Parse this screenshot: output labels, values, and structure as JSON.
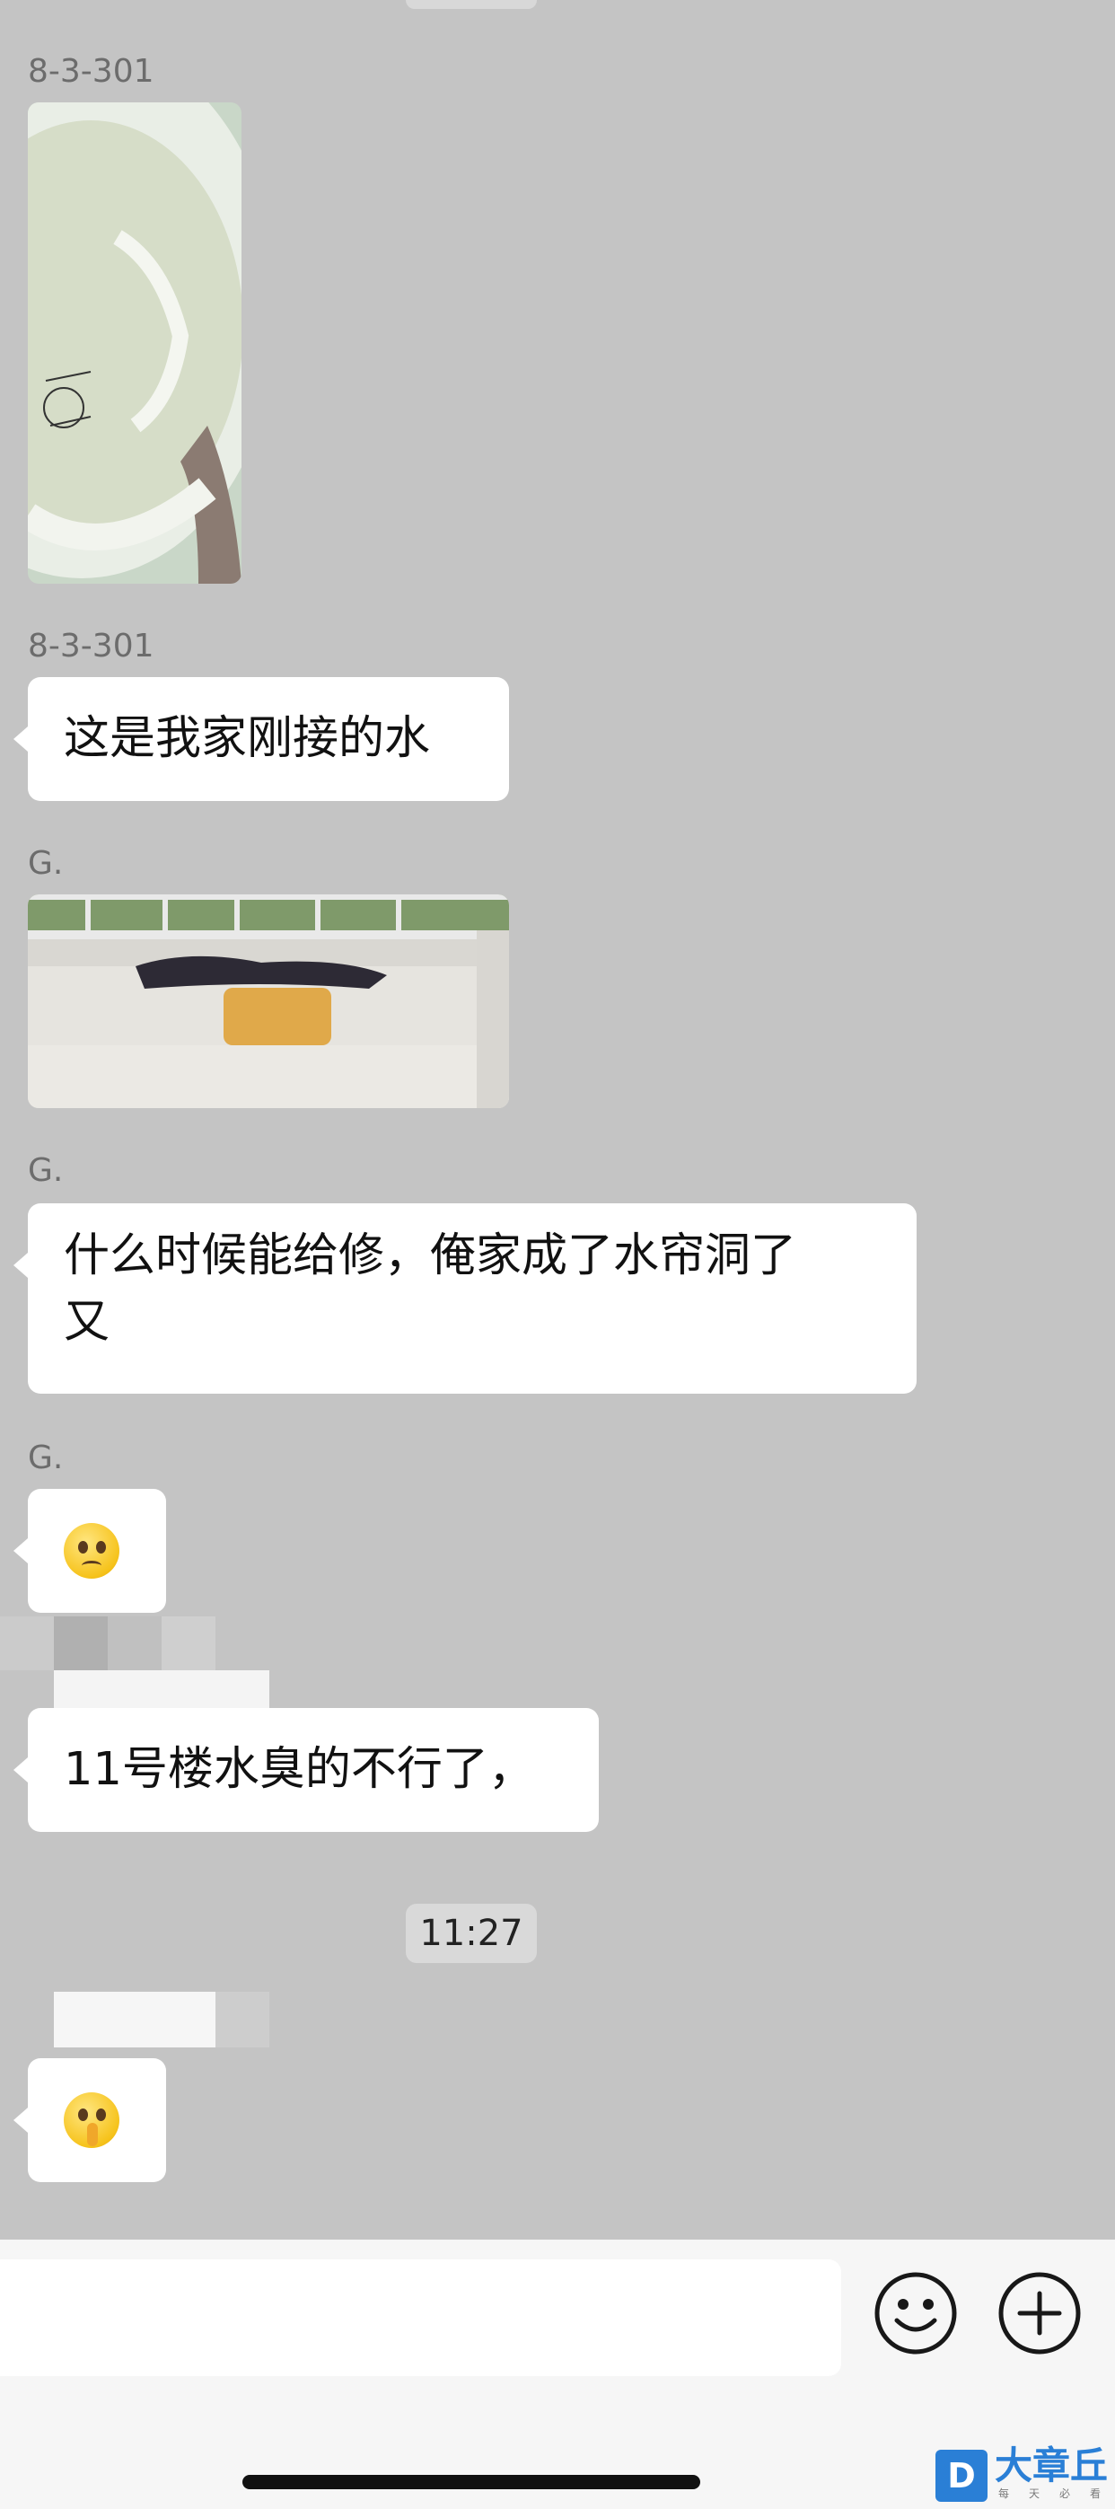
{
  "messages": [
    {
      "sender": "8-3-301",
      "type": "image"
    },
    {
      "sender": "8-3-301",
      "type": "text",
      "text": "这是我家刚接的水"
    },
    {
      "sender": "G.",
      "type": "image"
    },
    {
      "sender": "G.",
      "type": "text",
      "line1": "什么时候能给修，俺家成了水帘洞了",
      "line2": "又"
    },
    {
      "sender": "G.",
      "type": "emoji",
      "emoji": "worried-face-emoji"
    },
    {
      "sender": "",
      "type": "text",
      "text": "11号楼水臭的不行了，",
      "sender_obscured": true
    },
    {
      "sender": "",
      "type": "emoji",
      "emoji": "shushing-face-emoji",
      "sender_obscured": true
    }
  ],
  "timestamp": "11:27",
  "input_bar": {
    "value": "",
    "icons": [
      "smiley-icon",
      "plus-icon"
    ]
  },
  "watermark": {
    "logo_letter": "D",
    "title": "大章丘",
    "subtitle": "每天必看"
  },
  "colors": {
    "chat_background": "#c4c4c4",
    "bubble": "#ffffff",
    "input_bar": "#f6f6f6",
    "watermark_blue": "#2a7fd6"
  }
}
